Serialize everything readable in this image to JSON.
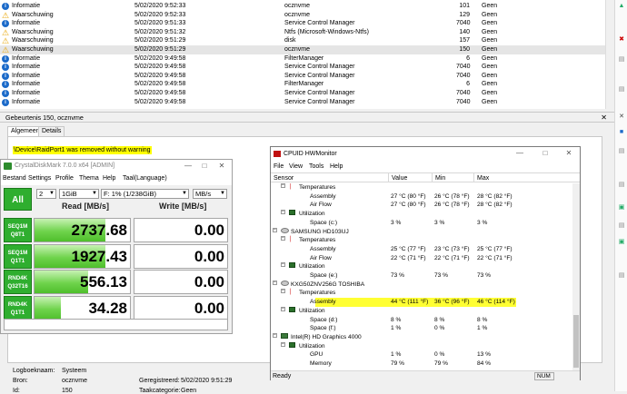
{
  "events": [
    {
      "level": "Informatie",
      "icon": "info",
      "date": "5/02/2020 9:52:33",
      "source": "ocznvme",
      "id": "101",
      "category": "Geen"
    },
    {
      "level": "Waarschuwing",
      "icon": "warning",
      "date": "5/02/2020 9:52:33",
      "source": "ocznvme",
      "id": "129",
      "category": "Geen"
    },
    {
      "level": "Informatie",
      "icon": "info",
      "date": "5/02/2020 9:51:33",
      "source": "Service Control Manager",
      "id": "7040",
      "category": "Geen"
    },
    {
      "level": "Waarschuwing",
      "icon": "warning",
      "date": "5/02/2020 9:51:32",
      "source": "Ntfs (Microsoft-Windows-Ntfs)",
      "id": "140",
      "category": "Geen"
    },
    {
      "level": "Waarschuwing",
      "icon": "warning",
      "date": "5/02/2020 9:51:29",
      "source": "disk",
      "id": "157",
      "category": "Geen"
    },
    {
      "level": "Waarschuwing",
      "icon": "warning",
      "date": "5/02/2020 9:51:29",
      "source": "ocznvme",
      "id": "150",
      "category": "Geen",
      "selected": true
    },
    {
      "level": "Informatie",
      "icon": "info",
      "date": "5/02/2020 9:49:58",
      "source": "FilterManager",
      "id": "6",
      "category": "Geen"
    },
    {
      "level": "Informatie",
      "icon": "info",
      "date": "5/02/2020 9:49:58",
      "source": "Service Control Manager",
      "id": "7040",
      "category": "Geen"
    },
    {
      "level": "Informatie",
      "icon": "info",
      "date": "5/02/2020 9:49:58",
      "source": "Service Control Manager",
      "id": "7040",
      "category": "Geen"
    },
    {
      "level": "Informatie",
      "icon": "info",
      "date": "5/02/2020 9:49:58",
      "source": "FilterManager",
      "id": "6",
      "category": "Geen"
    },
    {
      "level": "Informatie",
      "icon": "info",
      "date": "5/02/2020 9:49:58",
      "source": "Service Control Manager",
      "id": "7040",
      "category": "Geen"
    },
    {
      "level": "Informatie",
      "icon": "info",
      "date": "5/02/2020 9:49:58",
      "source": "Service Control Manager",
      "id": "7040",
      "category": "Geen"
    }
  ],
  "detail": {
    "header": "Gebeurtenis 150, ocznvme",
    "tabs": [
      "Algemeen",
      "Details"
    ],
    "message": "\\Device\\RaidPort1 was removed without warning",
    "logname_label": "Logboeknaam:",
    "logname_value": "Systeem",
    "source_label": "Bron:",
    "source_value": "ocznvme",
    "id_label": "Id:",
    "id_value": "150",
    "recorded_label": "Geregistreerd:",
    "recorded_value": "5/02/2020 9:51:29",
    "task_label": "Taakcategorie:",
    "task_value": "Geen"
  },
  "cdm": {
    "title": "CrystalDiskMark 7.0.0 x64 [ADMIN]",
    "menu": [
      "Bestand",
      "Settings",
      "Profile",
      "Thema",
      "Help",
      "Taal(Language)"
    ],
    "all_label": "All",
    "count": "2",
    "size": "1GiB",
    "drive": "F: 1% (1/238GiB)",
    "unit": "MB/s",
    "read_header": "Read [MB/s]",
    "write_header": "Write [MB/s]",
    "tests": [
      {
        "line1": "SEQ1M",
        "line2": "Q8T1",
        "read": "2737.68",
        "write": "0.00",
        "read_fraction": 0.74
      },
      {
        "line1": "SEQ1M",
        "line2": "Q1T1",
        "read": "1927.43",
        "write": "0.00",
        "read_fraction": 0.74
      },
      {
        "line1": "RND4K",
        "line2": "Q32T16",
        "read": "556.13",
        "write": "0.00",
        "read_fraction": 0.56
      },
      {
        "line1": "RND4K",
        "line2": "Q1T1",
        "read": "34.28",
        "write": "0.00",
        "read_fraction": 0.28
      }
    ]
  },
  "hwm": {
    "title": "CPUID HWMonitor",
    "menu": [
      "File",
      "View",
      "Tools",
      "Help"
    ],
    "columns": [
      "Sensor",
      "Value",
      "Min",
      "Max"
    ],
    "rows": [
      {
        "indent": 1,
        "icon": "temp",
        "tree": "minus",
        "name": "Temperatures",
        "value": "",
        "min": "",
        "max": ""
      },
      {
        "indent": 2,
        "name": "Assembly",
        "value": "27 °C  (80 °F)",
        "min": "26 °C  (78 °F)",
        "max": "28 °C  (82 °F)"
      },
      {
        "indent": 2,
        "name": "Air Flow",
        "value": "27 °C  (80 °F)",
        "min": "26 °C  (78 °F)",
        "max": "28 °C  (82 °F)"
      },
      {
        "indent": 1,
        "icon": "util",
        "tree": "minus",
        "name": "Utilization",
        "value": "",
        "min": "",
        "max": ""
      },
      {
        "indent": 2,
        "name": "Space (c:)",
        "value": "3 %",
        "min": "3 %",
        "max": "3 %"
      },
      {
        "indent": 0,
        "icon": "disk",
        "tree": "minus",
        "name": "SAMSUNG HD103UJ",
        "value": "",
        "min": "",
        "max": ""
      },
      {
        "indent": 1,
        "icon": "temp",
        "tree": "minus",
        "name": "Temperatures",
        "value": "",
        "min": "",
        "max": ""
      },
      {
        "indent": 2,
        "name": "Assembly",
        "value": "25 °C  (77 °F)",
        "min": "23 °C  (73 °F)",
        "max": "25 °C  (77 °F)"
      },
      {
        "indent": 2,
        "name": "Air Flow",
        "value": "22 °C  (71 °F)",
        "min": "22 °C  (71 °F)",
        "max": "22 °C  (71 °F)"
      },
      {
        "indent": 1,
        "icon": "util",
        "tree": "minus",
        "name": "Utilization",
        "value": "",
        "min": "",
        "max": ""
      },
      {
        "indent": 2,
        "name": "Space (e:)",
        "value": "73 %",
        "min": "73 %",
        "max": "73 %"
      },
      {
        "indent": 0,
        "icon": "disk",
        "tree": "minus",
        "name": "KXG50ZNV256G TOSHIBA",
        "value": "",
        "min": "",
        "max": ""
      },
      {
        "indent": 1,
        "icon": "temp",
        "tree": "minus",
        "name": "Temperatures",
        "value": "",
        "min": "",
        "max": ""
      },
      {
        "indent": 2,
        "name": "Assembly",
        "value": "44 °C  (111 °F)",
        "min": "36 °C  (96 °F)",
        "max": "46 °C  (114 °F)",
        "highlight": true
      },
      {
        "indent": 1,
        "icon": "util",
        "tree": "minus",
        "name": "Utilization",
        "value": "",
        "min": "",
        "max": ""
      },
      {
        "indent": 2,
        "name": "Space (d:)",
        "value": "8 %",
        "min": "8 %",
        "max": "8 %"
      },
      {
        "indent": 2,
        "name": "Space (f:)",
        "value": "1 %",
        "min": "0 %",
        "max": "1 %"
      },
      {
        "indent": 0,
        "icon": "gpu",
        "tree": "minus",
        "name": "Intel(R) HD Graphics 4000",
        "value": "",
        "min": "",
        "max": ""
      },
      {
        "indent": 1,
        "icon": "util",
        "tree": "minus",
        "name": "Utilization",
        "value": "",
        "min": "",
        "max": ""
      },
      {
        "indent": 2,
        "name": "GPU",
        "value": "1 %",
        "min": "0 %",
        "max": "13 %"
      },
      {
        "indent": 2,
        "name": "Memory",
        "value": "79 %",
        "min": "79 %",
        "max": "84 %"
      }
    ],
    "status": "Ready",
    "num": "NUM"
  }
}
